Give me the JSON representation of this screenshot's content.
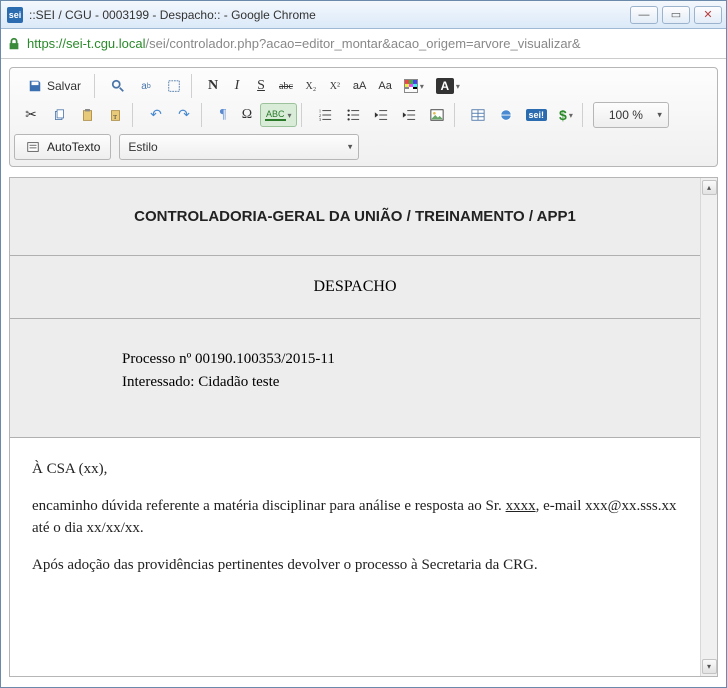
{
  "window": {
    "favicon_text": "sei",
    "title": "::SEI / CGU - 0003199 - Despacho:: - Google Chrome",
    "minimize": "—",
    "maximize": "▭",
    "close": "✕"
  },
  "address": {
    "https": "https",
    "host": "://sei-t.cgu.local",
    "path": "/sei/controlador.php?acao=editor_montar&acao_origem=arvore_visualizar&"
  },
  "toolbar": {
    "save": "Salvar",
    "bold_N": "N",
    "italic_I": "I",
    "strike_S": "S",
    "abc": "abc",
    "x2_sub": "X₂",
    "x2_sup": "X²",
    "aA": "aA",
    "Aa": "Aa",
    "A_box": "A",
    "pilcrow": "¶",
    "omega": "Ω",
    "abc_check": "ABC",
    "dollar": "$",
    "zoom": "100 %",
    "autotexto": "AutoTexto",
    "estilo": "Estilo",
    "sei_badge": "sei!"
  },
  "document": {
    "header": "CONTROLADORIA-GERAL DA UNIÃO / TREINAMENTO / APP1",
    "type": "DESPACHO",
    "processo": "Processo nº 00190.100353/2015-11",
    "interessado": "Interessado: Cidadão teste",
    "body1_a": "À CSA (xx),",
    "body2_a": "encaminho dúvida",
    "body2_b": " referente a matéria disciplinar para análise e resposta ao Sr. ",
    "body2_c": "xxxx",
    "body2_d": ", e-mail xxx@xx.sss.xx até o dia xx/xx/xx.",
    "body3": "Após adoção das providências pertinentes devolver o processo à Secretaria da CRG."
  }
}
